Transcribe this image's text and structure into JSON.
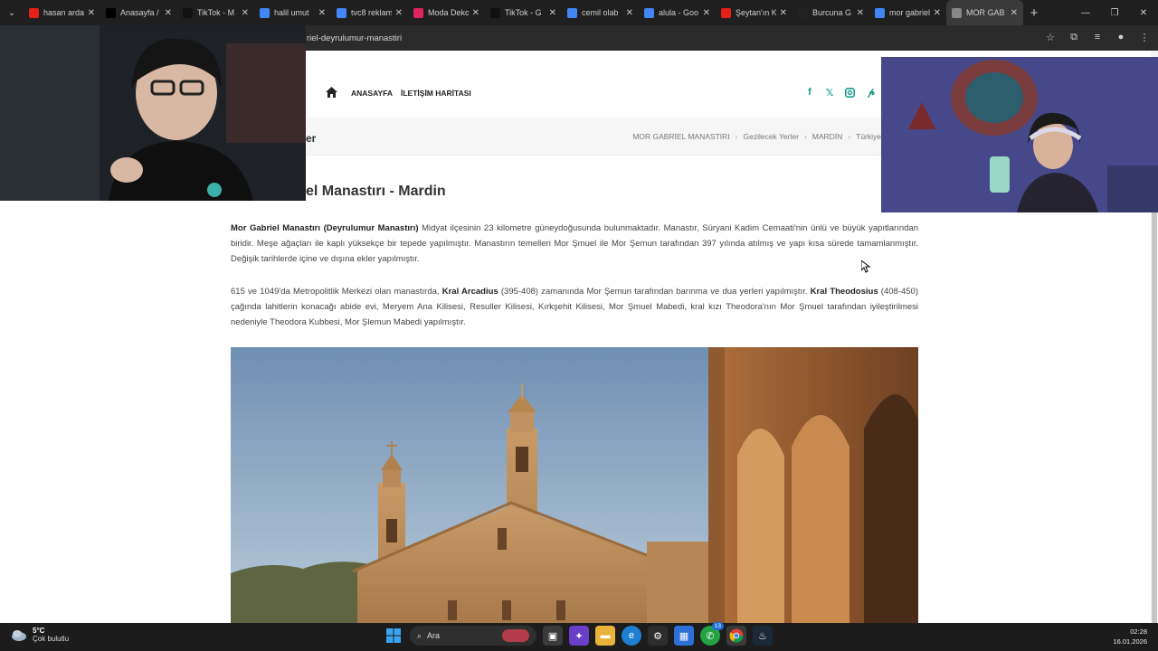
{
  "browser": {
    "tabs": [
      {
        "label": "hasan arda",
        "color": "#e62117"
      },
      {
        "label": "Anasayfa /",
        "color": "#000000"
      },
      {
        "label": "TikTok - M",
        "color": "#111111"
      },
      {
        "label": "halil umut",
        "color": "#4285f4"
      },
      {
        "label": "tvc8 reklam",
        "color": "#4285f4"
      },
      {
        "label": "Moda Deko",
        "color": "#e0245e"
      },
      {
        "label": "TikTok - G",
        "color": "#111111"
      },
      {
        "label": "cemil olab",
        "color": "#4285f4"
      },
      {
        "label": "alula - Goo",
        "color": "#4285f4"
      },
      {
        "label": "Şeytan'ın K",
        "color": "#e62117"
      },
      {
        "label": "Burcuna G",
        "color": "#222222"
      },
      {
        "label": "mor gabriel",
        "color": "#4285f4"
      },
      {
        "label": "MOR GAB",
        "color": "#888888"
      }
    ],
    "url": "riel-deyrulumur-manastiri"
  },
  "site": {
    "nav": {
      "home": "ANASAYFA",
      "map": "İLETİŞİM HARİTASI"
    },
    "social_icons": [
      "facebook-icon",
      "x-icon",
      "instagram-icon",
      "pinterest-icon"
    ],
    "category_partial": "er",
    "breadcrumbs": [
      "MOR GABRİEL MANASTIRI",
      "Gezilecek Yerler",
      "MARDİN",
      "Türkiye"
    ],
    "title_partial": "el Manastırı - Mardin",
    "para1": {
      "bold": "Mor Gabriel Manastırı (Deyrulumur Manastırı)",
      "text": " Midyat ilçesinin 23 kilometre güneydoğusunda bulunmaktadır. Manastır, Süryani Kadim Cemaati'nin ünlü ve büyük yapıtlarından biridir. Meşe ağaçları ile kaplı yüksekçe bir tepede yapılmıştır. Manastırın temelleri Mor Şmuel ile Mor Şemun tarafından 397 yılında atılmış ve yapı kısa sürede tamamlanmıştır. Değişik tarihlerde içine ve dışına ekler yapılmıştır."
    },
    "para2": {
      "t1": "615 ve 1049'da Metropolitlik Merkezi olan manastırda, ",
      "b1": "Kral Arcadius",
      "t2": " (395-408) zamanında Mor Şemun tarafından barınma ve dua yerleri yapılmıştır. ",
      "b2": "Kral Theodosius",
      "t3": " (408-450) çağında lahitlerin konacağı abide evi, Meryem Ana Kilisesi, Resuller Kilisesi, Kırkşehit Kilisesi, Mor Şmuel Mabedi, kral kızı Theodora'nın Mor Şmuel tarafından iyileştirilmesi nedeniyle Theodora Kubbesi, Mor Şlemun Mabedi yapılmıştır."
    }
  },
  "taskbar": {
    "temp": "5°C",
    "weather": "Çok bulutlu",
    "search_placeholder": "Ara",
    "badge": "13",
    "time": "02:28",
    "date": "16.01.2026"
  }
}
